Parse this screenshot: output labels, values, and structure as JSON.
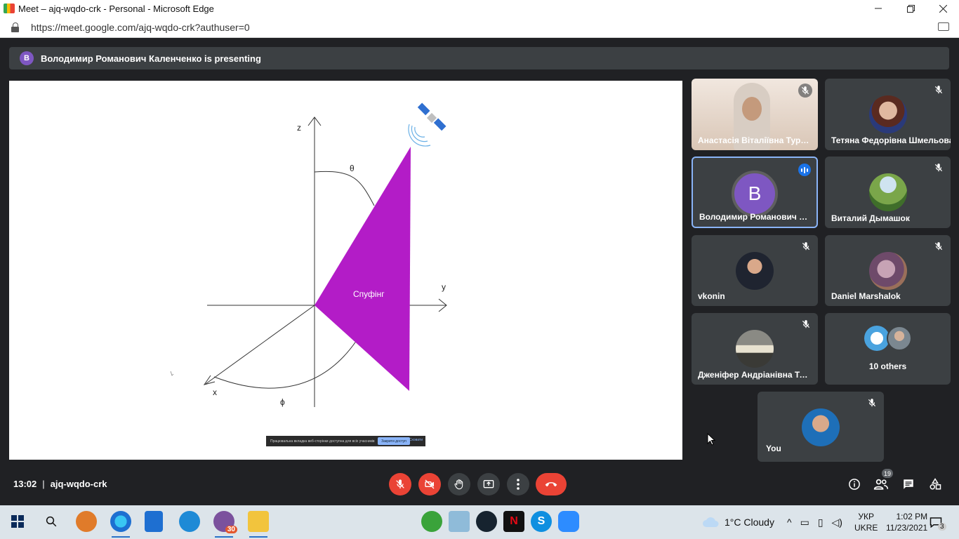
{
  "browser": {
    "window_title": "Meet – ajq-wqdo-crk - Personal - Microsoft Edge",
    "url": "https://meet.google.com/ajq-wqdo-crk?authuser=0"
  },
  "presenter_bar": {
    "avatar_letter": "В",
    "text": "Володимир Романович Каленченко is presenting"
  },
  "slide": {
    "label_z": "z",
    "label_y": "y",
    "label_x": "x",
    "label_theta": "θ",
    "label_phi": "ϕ",
    "triangle_label": "Спуфінг",
    "triangle_color": "#b31cc7"
  },
  "share_notice": {
    "text": "Працювальна вкладка веб-сторінки доступна для всіх учасників",
    "stop_label": "Закрити доступ",
    "hide_label": "Сховати"
  },
  "participants": [
    {
      "name": "Анастасія Віталіївна Туров...",
      "muted": true
    },
    {
      "name": "Тетяна Федорівна Шмельова",
      "muted": true
    },
    {
      "name": "Володимир Романович Кал...",
      "avatar_letter": "В",
      "speaking": true
    },
    {
      "name": "Виталий Дымашок",
      "muted": true
    },
    {
      "name": "vkonin",
      "muted": true
    },
    {
      "name": "Daniel Marshalok",
      "muted": true
    },
    {
      "name": "Дженіфер Андріанівна Тод...",
      "muted": true
    },
    {
      "name": "10 others"
    },
    {
      "name": "You",
      "muted": true
    }
  ],
  "meeting": {
    "time": "13:02",
    "separator": "|",
    "code": "ajq-wqdo-crk",
    "people_count": "19"
  },
  "taskbar": {
    "weather": "1°C  Cloudy",
    "lang_top": "УКР",
    "lang_bottom": "UKRE",
    "time": "1:02 PM",
    "date": "11/23/2021",
    "viber_badge": "30",
    "notif_badge": "3"
  },
  "colors": {
    "meet_bg": "#202124",
    "tile_bg": "#3c4043",
    "danger": "#ea4335",
    "accent": "#8ab4f8"
  }
}
